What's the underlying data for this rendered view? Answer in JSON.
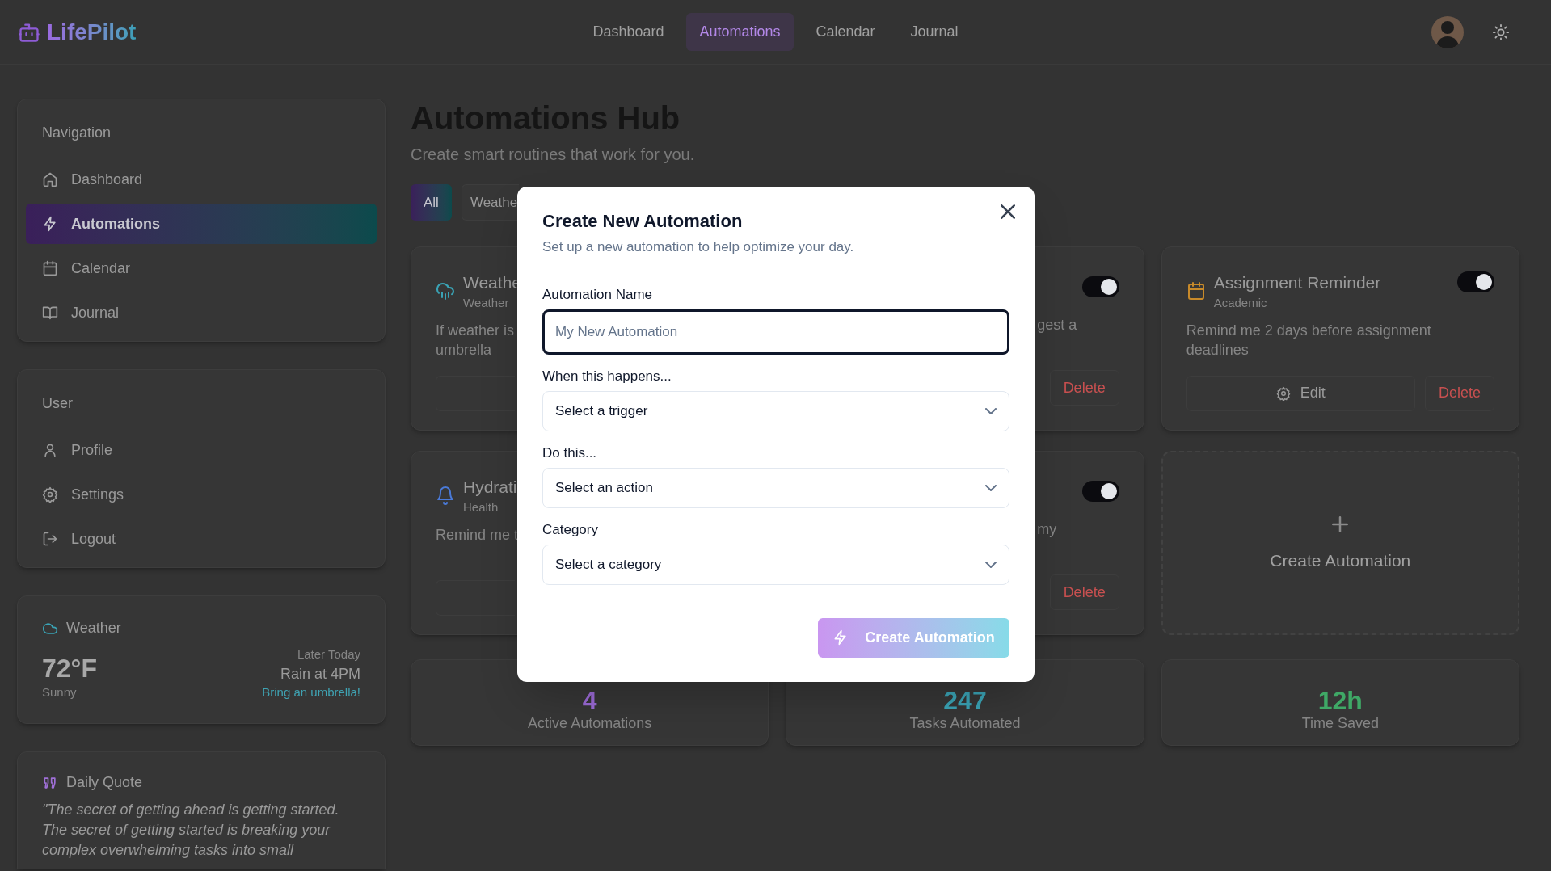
{
  "app": {
    "logo": "LifePilot"
  },
  "top_nav": [
    {
      "label": "Dashboard",
      "selected": false
    },
    {
      "label": "Automations",
      "selected": true
    },
    {
      "label": "Calendar",
      "selected": false
    },
    {
      "label": "Journal",
      "selected": false
    }
  ],
  "sidebar": {
    "navigation": {
      "title": "Navigation",
      "items": [
        {
          "label": "Dashboard",
          "selected": false
        },
        {
          "label": "Automations",
          "selected": true
        },
        {
          "label": "Calendar",
          "selected": false
        },
        {
          "label": "Journal",
          "selected": false
        }
      ]
    },
    "user": {
      "title": "User",
      "items": [
        {
          "label": "Profile"
        },
        {
          "label": "Settings"
        },
        {
          "label": "Logout"
        }
      ]
    },
    "weather": {
      "title": "Weather",
      "temperature": "72°F",
      "condition": "Sunny",
      "later_label": "Later Today",
      "forecast": "Rain at 4PM",
      "advice": "Bring an umbrella!"
    },
    "quote": {
      "title": "Daily Quote",
      "lines": [
        "\"The secret of getting ahead is getting started.",
        "The secret of getting started is breaking your",
        "complex overwhelming tasks into small"
      ]
    }
  },
  "main": {
    "title": "Automations Hub",
    "subtitle": "Create smart routines that work for you.",
    "filters": [
      {
        "label": "All",
        "selected": true
      },
      {
        "label": "Weathe",
        "selected": false
      }
    ],
    "cards": [
      {
        "kind": "left",
        "title": "Weathe",
        "category": "Weather",
        "lines": [
          "If weather is",
          "umbrella"
        ]
      },
      {
        "kind": "right",
        "on": true,
        "lines": [
          "gest a"
        ],
        "delete": "Delete"
      },
      {
        "kind": "full",
        "title": "Assignment Reminder",
        "category": "Academic",
        "on": true,
        "description": "Remind me 2 days before assignment deadlines",
        "edit": "Edit",
        "delete": "Delete"
      },
      {
        "kind": "left",
        "title": "Hydrati",
        "category": "Health",
        "lines": [
          "Remind me t"
        ]
      },
      {
        "kind": "right",
        "on": true,
        "lines": [
          "my"
        ],
        "delete": "Delete"
      },
      {
        "kind": "create",
        "label": "Create Automation"
      }
    ],
    "stats": [
      {
        "value": "4",
        "label": "Active Automations",
        "color": "#9b6ad6"
      },
      {
        "value": "247",
        "label": "Tasks Automated",
        "color": "#3aa3b5"
      },
      {
        "value": "12h",
        "label": "Time Saved",
        "color": "#3fa866"
      }
    ]
  },
  "modal": {
    "title": "Create New Automation",
    "subtitle": "Set up a new automation to help optimize your day.",
    "fields": [
      {
        "kind": "input",
        "label": "Automation Name",
        "placeholder": "My New Automation"
      },
      {
        "kind": "select",
        "label": "When this happens...",
        "value": "Select a trigger"
      },
      {
        "kind": "select",
        "label": "Do this...",
        "value": "Select an action"
      },
      {
        "kind": "select",
        "label": "Category",
        "value": "Select a category"
      }
    ],
    "submit": "Create Automation"
  }
}
